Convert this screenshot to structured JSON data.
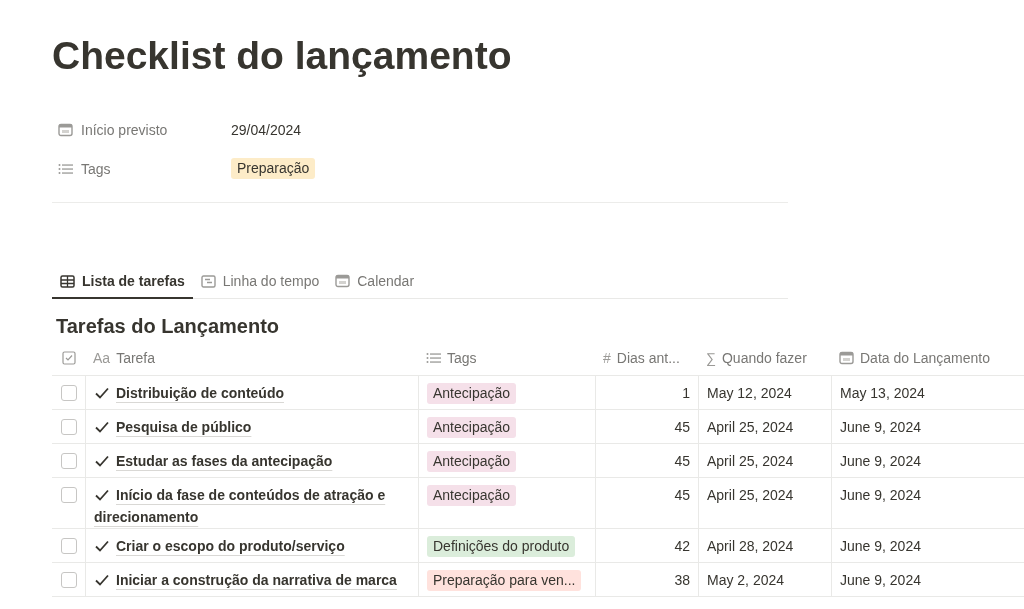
{
  "page": {
    "title": "Checklist do lançamento"
  },
  "properties": [
    {
      "kind": "date",
      "label": "Início previsto",
      "value": "29/04/2024"
    },
    {
      "kind": "tags",
      "label": "Tags",
      "tags": [
        {
          "label": "Preparação",
          "color": "#fdecc8"
        }
      ]
    }
  ],
  "tabs": [
    {
      "kind": "table",
      "label": "Lista de tarefas",
      "selected": true
    },
    {
      "kind": "timeline",
      "label": "Linha do tempo",
      "selected": false
    },
    {
      "kind": "calendar",
      "label": "Calendar",
      "selected": false
    }
  ],
  "table": {
    "title": "Tarefas do Lançamento",
    "columns": [
      {
        "kind": "checkbox"
      },
      {
        "kind": "title",
        "glyph": "Aa",
        "label": "Tarefa"
      },
      {
        "kind": "tags",
        "label": "Tags"
      },
      {
        "kind": "number",
        "glyph": "#",
        "label": "Dias ant..."
      },
      {
        "kind": "formula",
        "glyph": "∑",
        "label": "Quando fazer"
      },
      {
        "kind": "date",
        "label": "Data do Lançamento"
      }
    ],
    "rows": [
      {
        "checked": false,
        "task": "Distribuição de conteúdo",
        "tag": {
          "label": "Antecipação",
          "color": "#f5e0e9"
        },
        "days": "1",
        "when": "May 12, 2024",
        "launch": "May 13, 2024"
      },
      {
        "checked": false,
        "task": "Pesquisa de público",
        "tag": {
          "label": "Antecipação",
          "color": "#f5e0e9"
        },
        "days": "45",
        "when": "April 25, 2024",
        "launch": "June 9, 2024"
      },
      {
        "checked": false,
        "task": "Estudar as fases da antecipação",
        "tag": {
          "label": "Antecipação",
          "color": "#f5e0e9"
        },
        "days": "45",
        "when": "April 25, 2024",
        "launch": "June 9, 2024"
      },
      {
        "checked": false,
        "task": "Início da fase de conteúdos de atração e direcionamento",
        "tag": {
          "label": "Antecipação",
          "color": "#f5e0e9"
        },
        "days": "45",
        "when": "April 25, 2024",
        "launch": "June 9, 2024"
      },
      {
        "checked": false,
        "task": "Criar o escopo do produto/serviço",
        "tag": {
          "label": "Definições do produto",
          "color": "#dbeddb"
        },
        "days": "42",
        "when": "April 28, 2024",
        "launch": "June 9, 2024"
      },
      {
        "checked": false,
        "task": "Iniciar a construção da narrativa de marca",
        "tag": {
          "label": "Preparação para ven...",
          "color": "#ffe2dd"
        },
        "days": "38",
        "when": "May 2, 2024",
        "launch": "June 9, 2024"
      }
    ]
  }
}
